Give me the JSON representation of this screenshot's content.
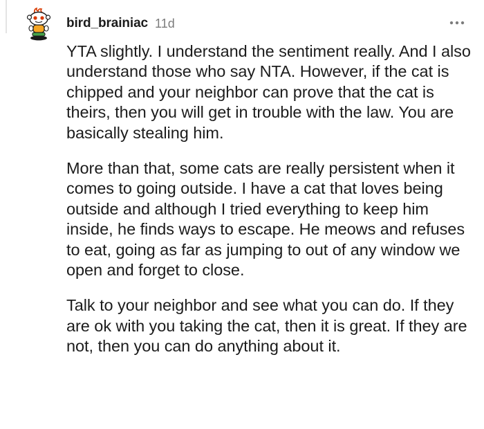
{
  "comment": {
    "username": "bird_brainiac",
    "age": "11d",
    "more_icon": "more-horizontal-icon",
    "avatar_icon": "snoo-avatar-icon",
    "paragraphs": [
      "YTA slightly. I understand the sentiment really. And I also understand those who say NTA. However, if the cat is chipped and your neighbor can prove that the cat is theirs, then you will get in trouble with the law. You are basically stealing him.",
      "More than that, some cats are really persistent when it comes to going outside. I have a cat that loves being outside and although I tried everything to keep him inside, he finds ways to escape. He meows and refuses to eat, going as far as jumping to out of any window we open and forget to close.",
      "Talk to your neighbor and see what you can do. If they are ok with you taking the cat, then it is great. If they are not, then you can do anything about it."
    ]
  },
  "colors": {
    "text": "#1c1c1c",
    "muted": "#7c7c7c",
    "avatar_red": "#d93a00",
    "avatar_orange": "#f5a623",
    "avatar_green": "#46a34a",
    "thread_line": "#e4e4e4"
  }
}
